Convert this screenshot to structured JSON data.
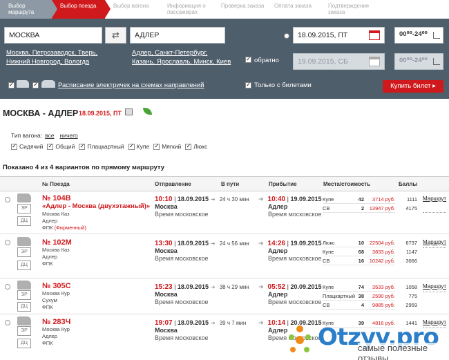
{
  "steps": [
    {
      "label": "Выбор маршрута",
      "state": "done"
    },
    {
      "label": "Выбор поезда",
      "state": "active"
    },
    {
      "label": "Выбор вагона",
      "state": "future"
    },
    {
      "label": "Информация о пассажирах",
      "state": "future"
    },
    {
      "label": "Проверка заказа",
      "state": "future"
    },
    {
      "label": "Оплата заказа",
      "state": "future"
    },
    {
      "label": "Подтверждение заказа",
      "state": "future"
    }
  ],
  "search": {
    "from": "МОСКВА",
    "to": "АДЛЕР",
    "from_links": [
      "Москва",
      "Петрозаводск",
      "Тверь",
      "Нижний Новгород",
      "Вологда"
    ],
    "to_links": [
      "Адлер",
      "Санкт-Петербург",
      "Казань",
      "Ярославль",
      "Минск",
      "Киев"
    ],
    "date": "18.09.2015, ПТ",
    "time": "00⁰⁰-24⁰⁰",
    "return_label": "обратно",
    "return_date": "19.09.2015, СБ",
    "return_time": "00⁰⁰-24⁰⁰",
    "schedule_link": "Расписание электричек на схемах направлений",
    "only_tickets": "Только с билетами",
    "buy_button": "Купить билет ▸"
  },
  "route": {
    "title": "МОСКВА - АДЛЕР",
    "date": "18.09.2015, ПТ"
  },
  "filters": {
    "label": "Тип вагона:",
    "all": "все",
    "none": "ничего",
    "types": [
      "Сидячий",
      "Общий",
      "Плацкартный",
      "Купе",
      "Мягкий",
      "Люкс"
    ]
  },
  "shown_text": "Показано 4 из 4 вариантов по прямому маршруту",
  "table": {
    "headers": {
      "num": "№ Поезда",
      "dep": "Отправление",
      "dur": "В пути",
      "arr": "Прибытие",
      "seats": "Места/стоимость",
      "pts": "Баллы"
    },
    "icons": {
      "er": "ЭР",
      "dc": "ДЦ"
    },
    "rows": [
      {
        "num": "№ 104В",
        "name": "«Адлер - Москва (двухэтажный)»",
        "from": "Москва Каз",
        "to": "Адлер",
        "carrier": "ФПК",
        "carrier_note": "(Фирменный)",
        "dep_time": "10:10",
        "dep_date": "18.09.2015",
        "dep_city": "Москва",
        "tz": "Время московское",
        "duration": "24 ч 30 мин",
        "arr_time": "10:40",
        "arr_date": "19.09.2015",
        "arr_city": "Адлер",
        "arr_tz": "Время московское",
        "seats": [
          {
            "cls": "Купе",
            "count": "42",
            "price": "3714 руб.",
            "points": "1111"
          },
          {
            "cls": "СВ",
            "count": "2",
            "price": "13947 руб.",
            "points": "4175"
          }
        ],
        "route_link": "Маршрут"
      },
      {
        "num": "№ 102М",
        "from": "Москва Каз",
        "to": "Адлер",
        "carrier": "ФПК",
        "dep_time": "13:30",
        "dep_date": "18.09.2015",
        "dep_city": "Москва",
        "tz": "Время московское",
        "duration": "24 ч 56 мин",
        "arr_time": "14:26",
        "arr_date": "19.09.2015",
        "arr_city": "Адлер",
        "arr_tz": "Время московское",
        "seats": [
          {
            "cls": "Люкс",
            "count": "10",
            "price": "22504 руб.",
            "points": "6737"
          },
          {
            "cls": "Купе",
            "count": "68",
            "price": "3833 руб.",
            "points": "1147"
          },
          {
            "cls": "СВ",
            "count": "16",
            "price": "10242 руб.",
            "points": "3066"
          }
        ],
        "route_link": "Маршрут"
      },
      {
        "num": "№ 305С",
        "from": "Москва Кур",
        "to": "Сухум",
        "carrier": "ФПК",
        "dep_time": "15:23",
        "dep_date": "18.09.2015",
        "dep_city": "Москва",
        "tz": "Время московское",
        "duration": "38 ч 29 мин",
        "arr_time": "05:52",
        "arr_date": "20.09.2015",
        "arr_city": "Адлер",
        "arr_tz": "Время московское",
        "seats": [
          {
            "cls": "Купе",
            "count": "74",
            "price": "3533 руб.",
            "points": "1058"
          },
          {
            "cls": "Плацкартный",
            "count": "38",
            "price": "2590 руб.",
            "points": "775"
          },
          {
            "cls": "СВ",
            "count": "4",
            "price": "9885 руб.",
            "points": "2959"
          }
        ],
        "route_link": "Маршрут"
      },
      {
        "num": "№ 283Ч",
        "from": "Москва Кур",
        "to": "Адлер",
        "carrier": "ФПК",
        "dep_time": "19:07",
        "dep_date": "18.09.2015",
        "dep_city": "Москва",
        "tz": "Время московское",
        "duration": "39 ч 7 мин",
        "arr_time": "10:14",
        "arr_date": "20.09.2015",
        "arr_city": "Адлер",
        "arr_tz": "Время московское",
        "seats": [
          {
            "cls": "Купе",
            "count": "39",
            "price": "4816 руб.",
            "points": "1441"
          }
        ],
        "route_link": "Маршрут"
      }
    ]
  },
  "watermark": {
    "brand": "Otzyv.pro",
    "tagline": "самые полезные отзывы"
  },
  "colors": {
    "accent": "#d0191c",
    "panel": "#4f5e6b",
    "watermark": "#2b7fc9"
  }
}
